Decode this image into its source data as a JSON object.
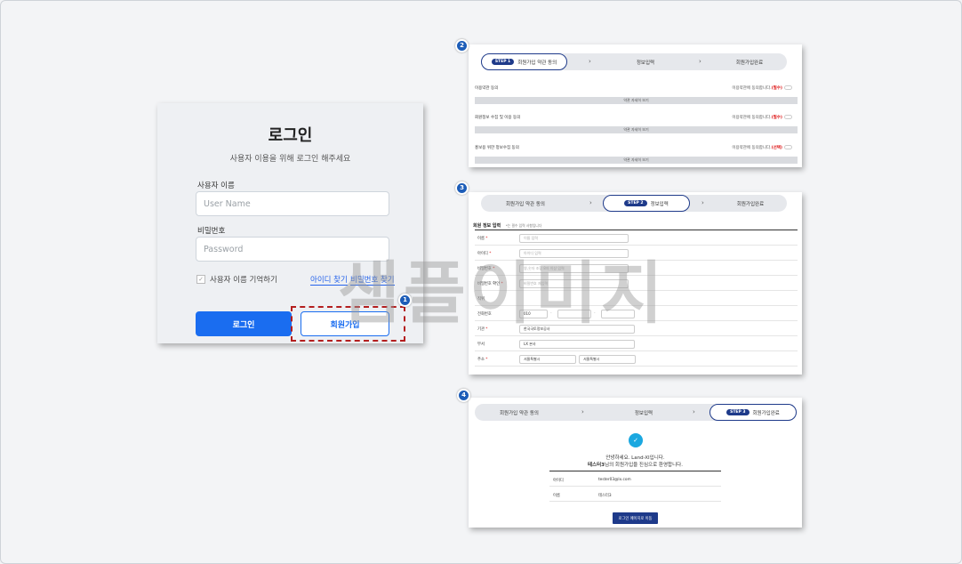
{
  "login": {
    "title": "로그인",
    "subtitle": "사용자 이용을 위해 로그인 해주세요",
    "username_label": "사용자 이름",
    "username_placeholder": "User Name",
    "password_label": "비밀번호",
    "password_placeholder": "Password",
    "remember_label": "사용자 이름 기억하기",
    "find_id": "아이디 찾기",
    "find_pw": "비밀번호 찾기",
    "login_button": "로그인",
    "join_button": "회원가입"
  },
  "badges": [
    "1",
    "2",
    "3",
    "4"
  ],
  "steps": {
    "step1_pill": "STEP 1",
    "step2_pill": "STEP 2",
    "step3_pill": "STEP 3",
    "s1": "회원가입 약관 동의",
    "s2": "정보입력",
    "s3": "회원가입완료"
  },
  "agreements": [
    {
      "title": "이용약관 동의",
      "right": "이용약관에 동의합니다.",
      "req": "(필수)"
    },
    {
      "title": "회원정보 수집 및 이용 동의",
      "right": "이용약관에 동의합니다.",
      "req": "(필수)"
    },
    {
      "title": "홍보용 위한 정보수집 동의",
      "right": "이용약관에 동의합니다.",
      "req": "(선택)"
    }
  ],
  "expand_label": "약관 자세히 보기",
  "form": {
    "section_title": "회원 정보 입력",
    "section_note": "*는 필수 입력 사항입니다",
    "fields": [
      {
        "label": "이름",
        "req": "*",
        "ph": "이름 입력"
      },
      {
        "label": "아이디",
        "req": "*",
        "ph": "아이디 입력"
      },
      {
        "label": "비밀번호",
        "req": "*",
        "ph": "영,숫자 조합 8자 이상 입력"
      },
      {
        "label": "비밀번호 확인",
        "req": "*",
        "ph": "비밀번호 재입력"
      },
      {
        "label": "직위",
        "req": "",
        "ph": ""
      },
      {
        "label": "전화번호",
        "req": "",
        "ph": "010"
      },
      {
        "label": "기관",
        "req": "*",
        "ph": "한국국토정보공사"
      },
      {
        "label": "부서",
        "req": "",
        "ph": "LX 본사"
      },
      {
        "label": "주소",
        "req": "*",
        "ph": "서울특별시"
      }
    ],
    "addr2": "서울특별시"
  },
  "complete": {
    "greeting": "안녕하세요. Land-XI입니다.",
    "name_bold": "테스터3",
    "welcome": "님의 회원가입을 진심으로 환영합니다.",
    "rows": [
      {
        "k": "아이디",
        "v": "tester03@lx.com"
      },
      {
        "k": "이름",
        "v": "테스터3"
      }
    ],
    "button": "로그인 페이지로 이동"
  },
  "watermark": "샘플이미지",
  "colors": {
    "primary": "#1a6df0",
    "navy": "#1e3a8a",
    "badge": "#1d5db8",
    "highlight": "#b41e1e"
  }
}
